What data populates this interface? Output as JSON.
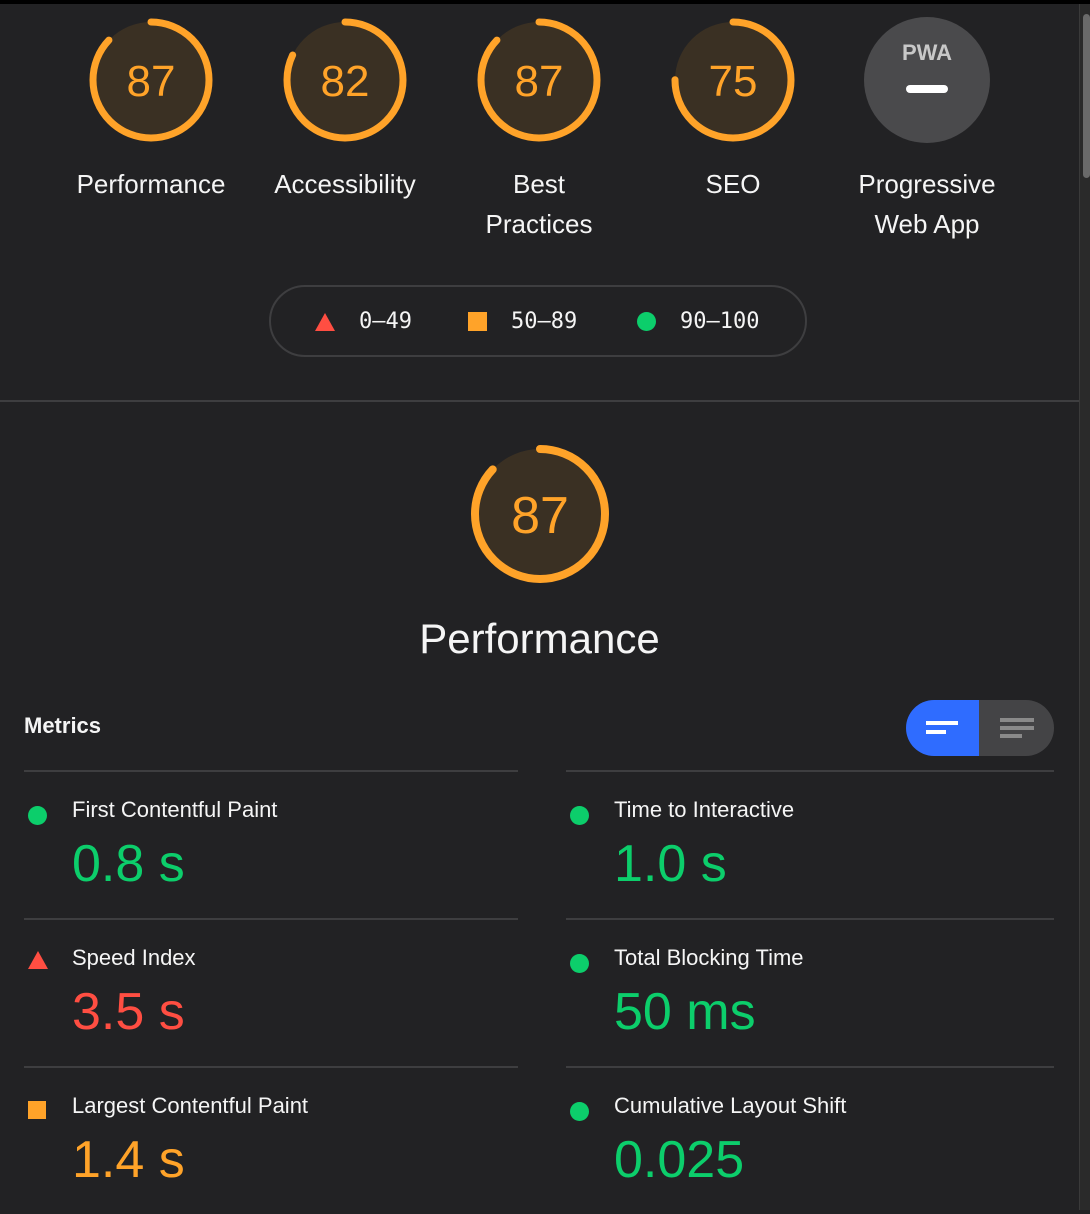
{
  "colors": {
    "fail": "#ff4e42",
    "average": "#ffa329",
    "pass": "#0cce6b",
    "toggle_active": "#2f6cff"
  },
  "categories": [
    {
      "label": "Performance",
      "score": 87,
      "rating": "average"
    },
    {
      "label": "Accessibility",
      "score": 82,
      "rating": "average"
    },
    {
      "label": "Best Practices",
      "score": 87,
      "rating": "average"
    },
    {
      "label": "SEO",
      "score": 75,
      "rating": "average"
    },
    {
      "label": "Progressive Web App",
      "badge": "PWA",
      "score": null,
      "rating": "na"
    }
  ],
  "legend": [
    {
      "icon": "triangle-icon",
      "range": "0–49"
    },
    {
      "icon": "square-icon",
      "range": "50–89"
    },
    {
      "icon": "circle-icon",
      "range": "90–100"
    }
  ],
  "section": {
    "title": "Performance",
    "score": 87
  },
  "metrics": {
    "title": "Metrics",
    "view_toggle": {
      "active": "compact"
    },
    "items": [
      {
        "name": "First Contentful Paint",
        "value": "0.8 s",
        "rating": "pass"
      },
      {
        "name": "Time to Interactive",
        "value": "1.0 s",
        "rating": "pass"
      },
      {
        "name": "Speed Index",
        "value": "3.5 s",
        "rating": "fail"
      },
      {
        "name": "Total Blocking Time",
        "value": "50 ms",
        "rating": "pass"
      },
      {
        "name": "Largest Contentful Paint",
        "value": "1.4 s",
        "rating": "average"
      },
      {
        "name": "Cumulative Layout Shift",
        "value": "0.025",
        "rating": "pass"
      }
    ]
  }
}
